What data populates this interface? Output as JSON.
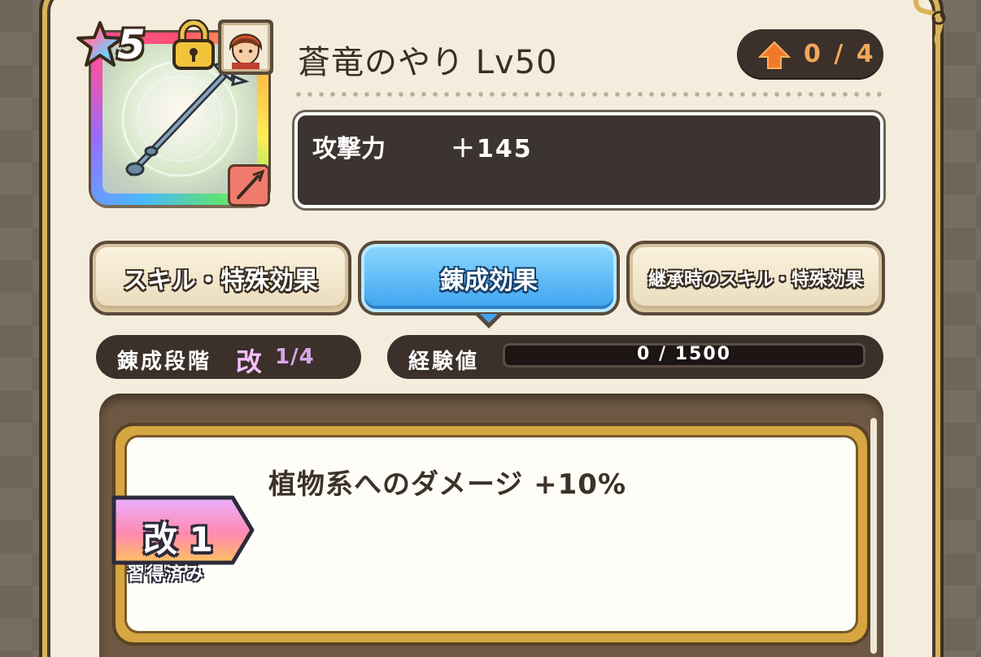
{
  "item": {
    "rarity": "5",
    "title": "蒼竜のやり Lv50",
    "upgrade_count": "0 / 4",
    "stat_label": "攻撃力",
    "stat_value": "＋145",
    "locked": true,
    "type": "spear",
    "icons": {
      "rarity": "star-icon",
      "lock": "lock-icon",
      "character": "character-portrait",
      "type": "spear-type-icon",
      "upgrade": "up-arrow-icon"
    }
  },
  "tabs": [
    {
      "label": "スキル・特殊効果",
      "active": false
    },
    {
      "label": "錬成効果",
      "active": true
    },
    {
      "label": "継承時のスキル・特殊効果",
      "active": false
    }
  ],
  "refine": {
    "label": "錬成段階",
    "kai_symbol": "改",
    "level": "1/4"
  },
  "exp": {
    "label": "経験値",
    "value_text": "0 / 1500",
    "progress": 0
  },
  "effects": [
    {
      "text": "植物系へのダメージ +10%",
      "tag_title": "改 1",
      "tag_status": "習得済み"
    }
  ],
  "colors": {
    "panel": "#f3ebdb",
    "active_tab": "#3ea4ee",
    "dark_pill": "#3b302a",
    "upgrade_text": "#f0a85a"
  }
}
